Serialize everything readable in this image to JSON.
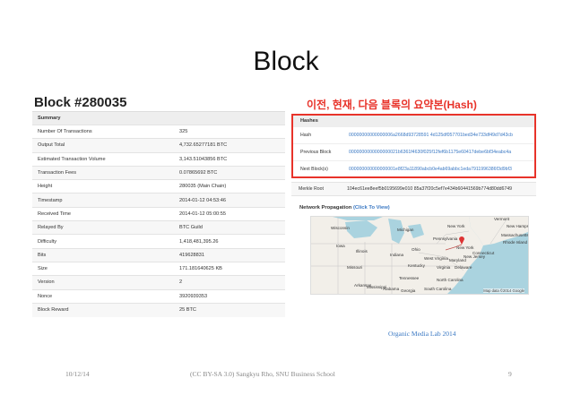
{
  "slide": {
    "title": "Block",
    "block_heading": "Block #280035",
    "annotation": "이전, 현재, 다음 블록의 요약본(Hash)"
  },
  "summary": {
    "header": "Summary",
    "rows": [
      {
        "label": "Number Of Transactions",
        "value": "325",
        "style": ""
      },
      {
        "label": "Output Total",
        "value": "4,732.65277181 BTC",
        "style": ""
      },
      {
        "label": "Estimated Transaction Volume",
        "value": "3,143.51043856 BTC",
        "style": ""
      },
      {
        "label": "Transaction Fees",
        "value": "0.07865692 BTC",
        "style": ""
      },
      {
        "label": "Height",
        "value": "280035 (Main Chain)",
        "style": "green"
      },
      {
        "label": "Timestamp",
        "value": "2014-01-12 04:53:46",
        "style": ""
      },
      {
        "label": "Received Time",
        "value": "2014-01-12 05:00:55",
        "style": ""
      },
      {
        "label": "Relayed By",
        "value": "BTC Guild",
        "style": "link"
      },
      {
        "label": "Difficulty",
        "value": "1,418,481,395.26",
        "style": ""
      },
      {
        "label": "Bits",
        "value": "419628831",
        "style": ""
      },
      {
        "label": "Size",
        "value": "171.181640625 KB",
        "style": ""
      },
      {
        "label": "Version",
        "value": "2",
        "style": ""
      },
      {
        "label": "Nonce",
        "value": "3920939353",
        "style": ""
      },
      {
        "label": "Block Reward",
        "value": "25 BTC",
        "style": ""
      }
    ]
  },
  "hashes": {
    "header": "Hashes",
    "rows": [
      {
        "label": "Hash",
        "value": "00000000000000006a2668d93728591 4d125df057701bed34e733df49d7d43cb"
      },
      {
        "label": "Previous Block",
        "value": "0000000000000000021b6361f4630f025f12fef6b1175e60417debe6bf34eabc4a"
      },
      {
        "label": "Next Block(s)",
        "value": "000000000000000001e8f23a11890abcb0e4ab69abbc1eda7911996386f3d9bf3"
      }
    ],
    "merkle_label": "Merkle Root",
    "merkle_value": "104ec61ee8eef5b0195699e010 85a37f20c5ef7e434b60441569b774d80dd6749"
  },
  "network": {
    "title": "Network Propagation",
    "link": "(Click To View)",
    "map_credit": "Map data ©2014 Google",
    "map_labels": [
      "Wisconsin",
      "Iowa",
      "Illinois",
      "Missouri",
      "Arkansas",
      "Michigan",
      "Indiana",
      "Ohio",
      "Kentucky",
      "Tennessee",
      "Pennsylvania",
      "New York",
      "West Virginia",
      "Virginia",
      "North Carolina",
      "South Carolina",
      "Mississippi",
      "Alabama",
      "Georgia",
      "Vermont",
      "New Hampshire",
      "Massachusetts",
      "Rhode Island",
      "Connecticut",
      "New Jersey",
      "Maryland",
      "Delaware",
      "New York"
    ]
  },
  "footer": {
    "org_lab": "Organic Media Lab 2014",
    "date": "10/12/14",
    "credit": "(CC BY-SA 3.0) Sangkyu Rho, SNU Business School",
    "page": "9"
  },
  "colors": {
    "accent_red": "#e8332a",
    "link_blue": "#3a78c3",
    "chain_green": "#3c9a3c"
  }
}
